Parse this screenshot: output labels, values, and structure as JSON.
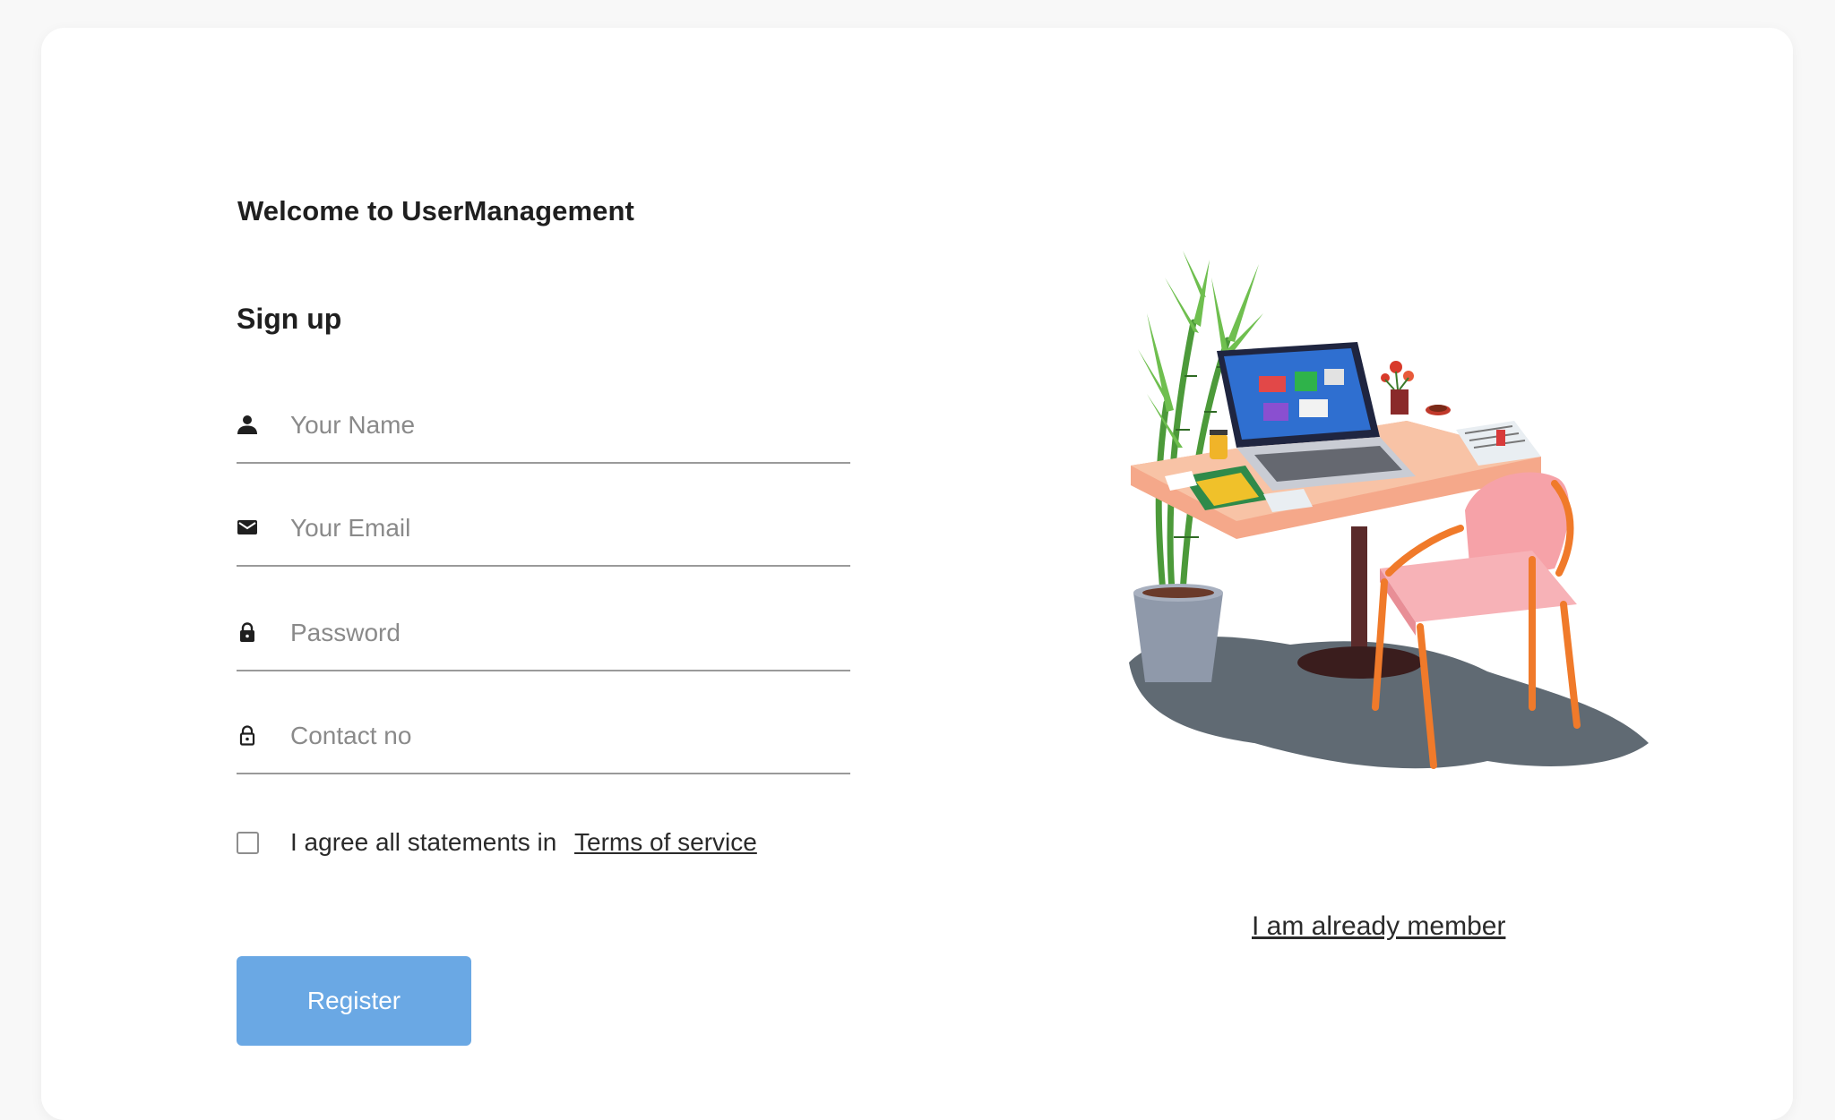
{
  "header": {
    "welcome": "Welcome to UserManagement",
    "title": "Sign up"
  },
  "form": {
    "name": {
      "icon": "person-icon",
      "placeholder": "Your Name",
      "value": ""
    },
    "email": {
      "icon": "envelope-icon",
      "placeholder": "Your Email",
      "value": ""
    },
    "password": {
      "icon": "lock-icon",
      "placeholder": "Password",
      "value": ""
    },
    "contact": {
      "icon": "lock-outline-icon",
      "placeholder": "Contact no",
      "value": ""
    },
    "agree_text": "I agree all statements in",
    "terms_link": "Terms of service",
    "agree_checked": false,
    "register_label": "Register"
  },
  "side": {
    "illustration": "desk-workspace-illustration",
    "member_link": "I am already member"
  },
  "colors": {
    "background": "#f8f8f8",
    "card": "#ffffff",
    "primary_button": "#6aa8e4",
    "text": "#222222",
    "placeholder": "#8a8a8a",
    "underline": "#9a9a9a"
  }
}
